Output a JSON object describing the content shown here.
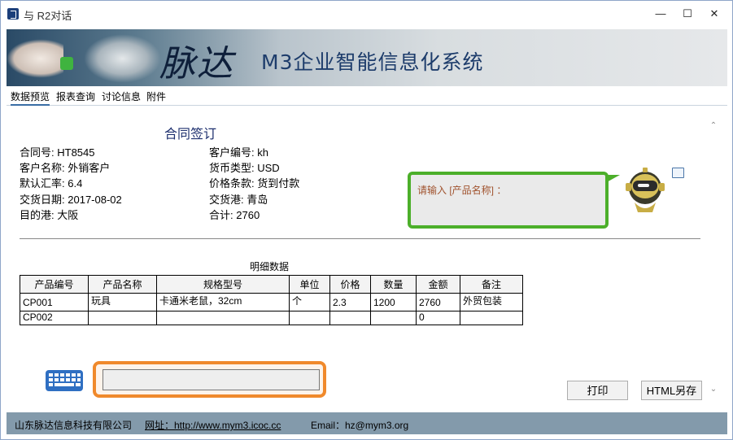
{
  "window": {
    "title": "与 R2对话"
  },
  "banner": {
    "calligraphy": "脉达",
    "system_name": "M3企业智能信息化系统"
  },
  "tabs": [
    "数据预览",
    "报表查询",
    "讨论信息",
    "附件"
  ],
  "form": {
    "title": "合同签订",
    "left": [
      {
        "label": "合同号:",
        "value": "HT8545"
      },
      {
        "label": "客户名称:",
        "value": "外销客户"
      },
      {
        "label": "默认汇率:",
        "value": "6.4"
      },
      {
        "label": "交货日期:",
        "value": "2017-08-02"
      },
      {
        "label": "目的港:",
        "value": "大阪"
      }
    ],
    "right": [
      {
        "label": "客户编号:",
        "value": "kh"
      },
      {
        "label": "货币类型:",
        "value": "USD"
      },
      {
        "label": "价格条款:",
        "value": "货到付款"
      },
      {
        "label": "交货港:",
        "value": "青岛"
      },
      {
        "label": "合计:",
        "value": "2760"
      }
    ]
  },
  "chat": {
    "prompt": "请输入 [产品名称] ："
  },
  "detail": {
    "title": "明细数据",
    "columns": [
      "产品编号",
      "产品名称",
      "规格型号",
      "单位",
      "价格",
      "数量",
      "金额",
      "备注"
    ],
    "rows": [
      [
        "CP001",
        "玩具",
        "卡通米老鼠，32cm",
        "个",
        "2.3",
        "1200",
        "2760",
        "外贸包装"
      ],
      [
        "CP002",
        "",
        "",
        "",
        "",
        "",
        "0",
        ""
      ]
    ]
  },
  "buttons": {
    "print": "打印",
    "save_html": "HTML另存"
  },
  "footer": {
    "company": "山东脉达信息科技有限公司",
    "website": "网址：http://www.mym3.icoc.cc",
    "email": "Email：hz@mym3.org"
  },
  "colors": {
    "accent_green": "#4caf2a",
    "accent_orange": "#f0892b",
    "footer_bg": "#839aab",
    "title_blue": "#1d2f6e"
  }
}
